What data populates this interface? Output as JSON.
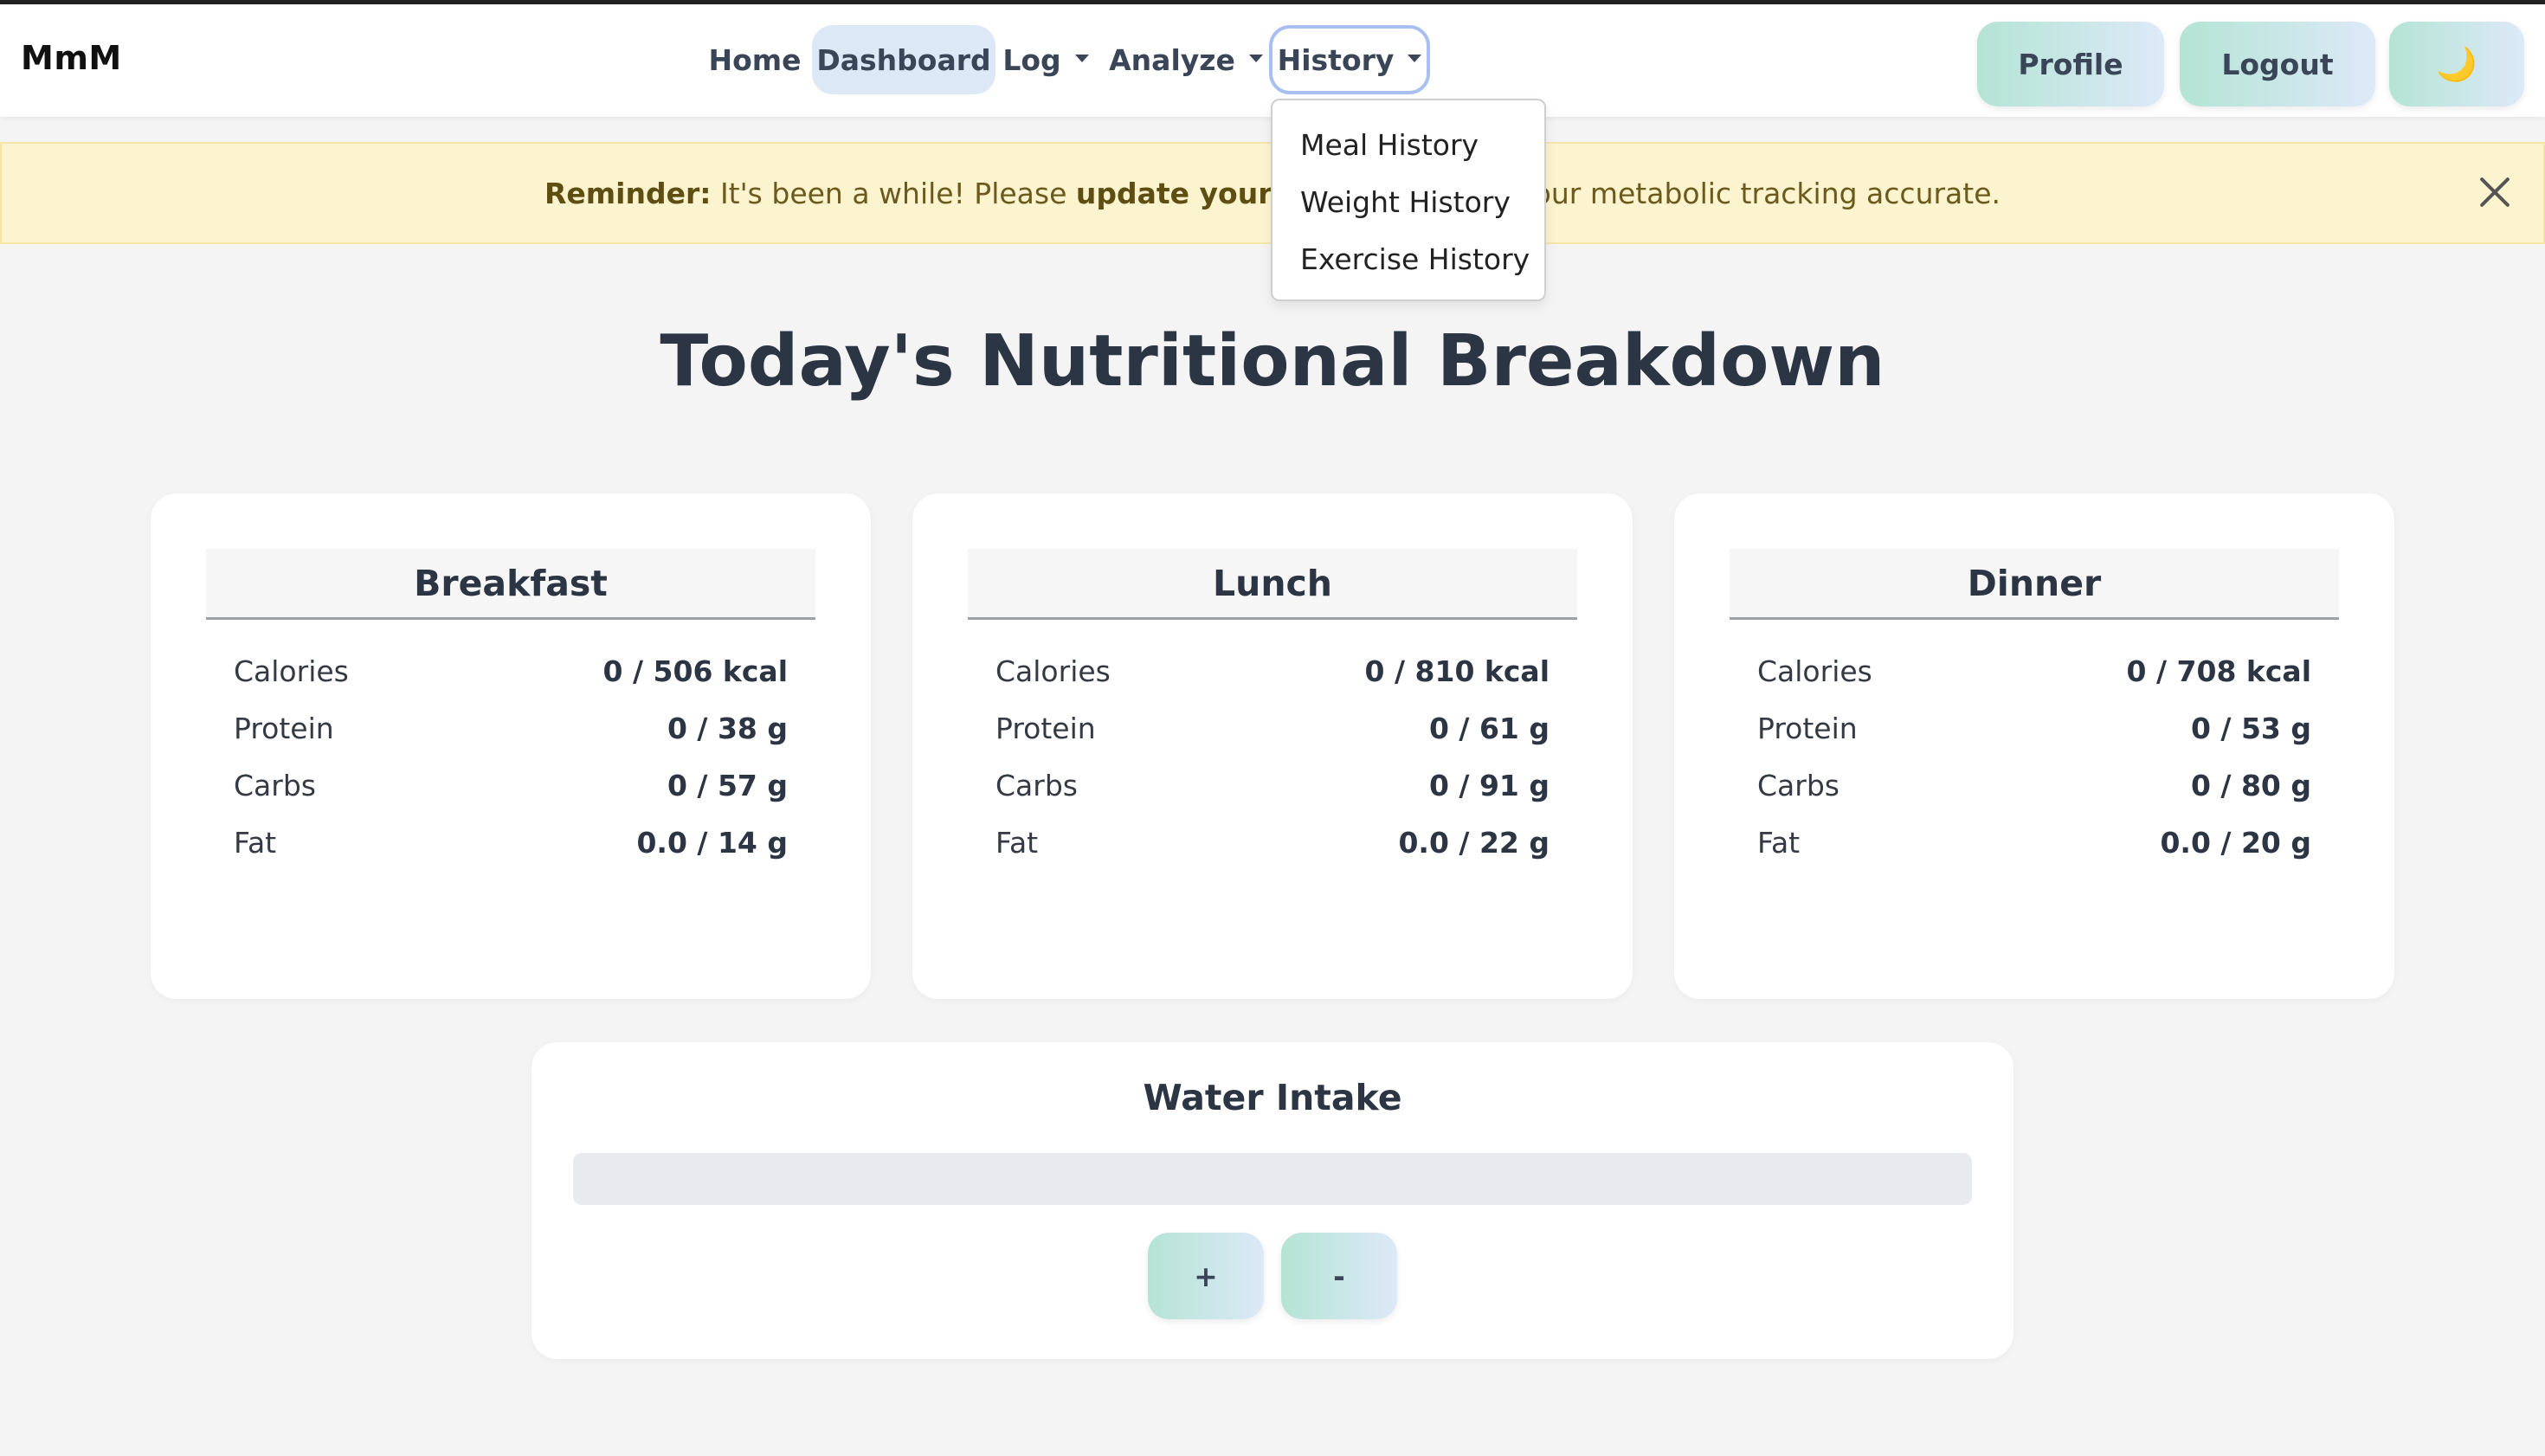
{
  "app": {
    "brand": "MmM"
  },
  "nav": {
    "links": [
      {
        "label": "Home"
      },
      {
        "label": "Dashboard"
      },
      {
        "label": "Log"
      },
      {
        "label": "Analyze"
      },
      {
        "label": "History"
      }
    ],
    "profile_label": "Profile",
    "logout_label": "Logout",
    "theme_toggle_icon": "moon-icon",
    "theme_toggle_glyph": "🌙"
  },
  "alert": {
    "strong_prefix": "Reminder:",
    "text_before": " It's been a while! Please ",
    "strong_middle": "update your weight",
    "text_after": " to keep your metabolic tracking accurate."
  },
  "history_dropdown": {
    "items": [
      "Meal History",
      "Weight History",
      "Exercise History"
    ]
  },
  "page": {
    "title": "Today's Nutritional Breakdown"
  },
  "meals": [
    {
      "name": "Breakfast",
      "rows": [
        {
          "label": "Calories",
          "value": "0 / 506 kcal"
        },
        {
          "label": "Protein",
          "value": "0 / 38 g"
        },
        {
          "label": "Carbs",
          "value": "0 / 57 g"
        },
        {
          "label": "Fat",
          "value": "0.0 / 14 g"
        }
      ]
    },
    {
      "name": "Lunch",
      "rows": [
        {
          "label": "Calories",
          "value": "0 / 810 kcal"
        },
        {
          "label": "Protein",
          "value": "0 / 61 g"
        },
        {
          "label": "Carbs",
          "value": "0 / 91 g"
        },
        {
          "label": "Fat",
          "value": "0.0 / 22 g"
        }
      ]
    },
    {
      "name": "Dinner",
      "rows": [
        {
          "label": "Calories",
          "value": "0 / 708 kcal"
        },
        {
          "label": "Protein",
          "value": "0 / 53 g"
        },
        {
          "label": "Carbs",
          "value": "0 / 80 g"
        },
        {
          "label": "Fat",
          "value": "0.0 / 20 g"
        }
      ]
    }
  ],
  "water": {
    "title": "Water Intake",
    "progress_fraction": 0,
    "plus_label": "+",
    "minus_label": "-"
  },
  "colors": {
    "accent_gradient_start": "#b4e4d4",
    "accent_gradient_end": "#dde9f8",
    "alert_bg": "#fcf3cf",
    "active_nav_bg": "#dde8f7"
  }
}
